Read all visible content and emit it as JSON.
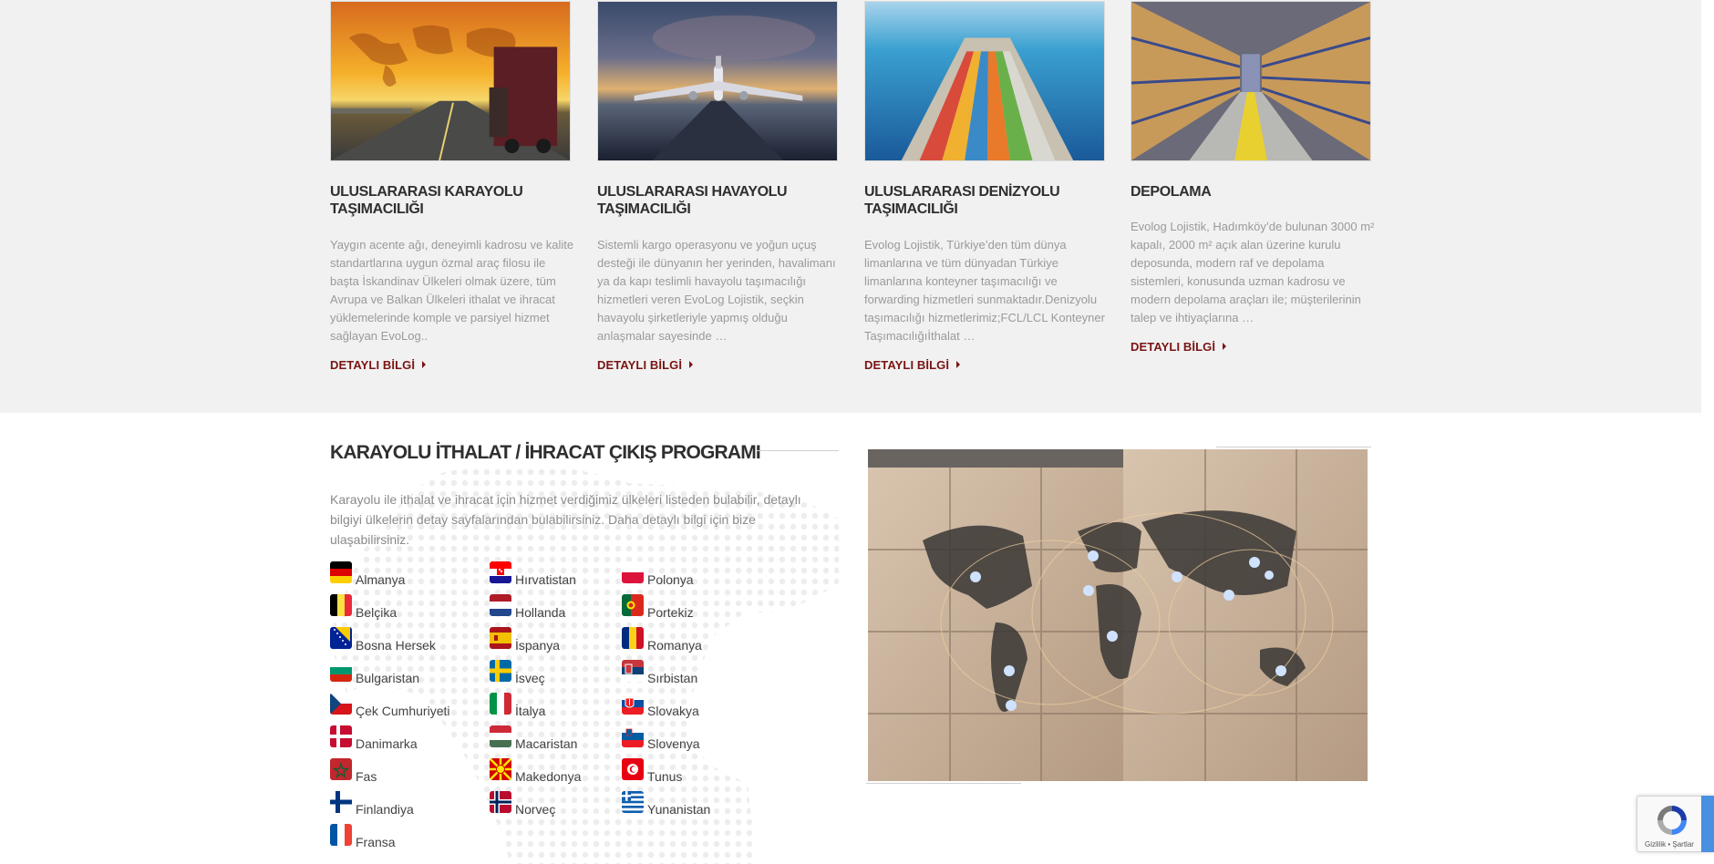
{
  "services": [
    {
      "title": "ULUSLARARASI KARAYOLU TAŞIMACILIĞI",
      "description": "Yaygın acente ağı, deneyimli kadrosu ve kalite standartlarına uygun özmal araç filosu ile başta İskandinav Ülkeleri olmak üzere, tüm Avrupa ve Balkan Ülkeleri ithalat ve ihracat yüklemelerinde komple ve parsiyel hizmet sağlayan EvoLog..",
      "link": "DETAYLI BİLGİ",
      "image": "truck-sunset-photo"
    },
    {
      "title": "ULUSLARARASI HAVAYOLU TAŞIMACILIĞI",
      "description": "Sistemli kargo operasyonu ve yoğun uçuş desteği ile dünyanın her yerinden, havalimanı ya da kapı teslimli havayolu taşımacılığı hizmetleri veren EvoLog Lojistik, seçkin havayolu şirketleriyle yapmış olduğu anlaşmalar sayesinde …",
      "link": "DETAYLI BİLGİ",
      "image": "airplane-runway-photo"
    },
    {
      "title": "ULUSLARARASI DENİZYOLU TAŞIMACILIĞI",
      "description": "Evolog Lojistik, Türkiye’den tüm dünya limanlarına ve tüm dünyadan Türkiye limanlarına konteyner taşımacılığı ve forwarding hizmetleri sunmaktadır.Denizyolu taşımacılığı hizmetlerimiz;FCL/LCL Konteyner Taşımacılığıİthalat …",
      "link": "DETAYLI BİLGİ",
      "image": "container-ship-photo"
    },
    {
      "title": "DEPOLAMA",
      "description": "Evolog Lojistik, Hadımköy’de bulunan 3000 m² kapalı, 2000 m² açık alan üzerine kurulu deposunda, modern raf ve depolama sistemleri, konusunda uzman kadrosu ve modern depolama araçları ile; müşterilerinin talep ve ihtiyaçlarına …",
      "link": "DETAYLI BİLGİ",
      "image": "warehouse-photo"
    }
  ],
  "program": {
    "title": "KARAYOLU İTHALAT / İHRACAT ÇIKIŞ PROGRAMI",
    "description": "Karayolu ile ithalat ve ihracat için hizmet verdiğimiz ülkeleri listeden bulabilir, detaylı bilgiyi ülkelerin detay sayfalarından bulabilirsiniz. Daha detaylı bilgi için bize ulaşabilirsiniz.",
    "columns": [
      [
        {
          "name": "Almanya",
          "flag": "germany"
        },
        {
          "name": "Belçika",
          "flag": "belgium"
        },
        {
          "name": "Bosna Hersek",
          "flag": "bosnia"
        },
        {
          "name": "Bulgaristan",
          "flag": "bulgaria"
        },
        {
          "name": "Çek Cumhuriyeti",
          "flag": "czech"
        },
        {
          "name": "Danimarka",
          "flag": "denmark"
        },
        {
          "name": "Fas",
          "flag": "morocco"
        },
        {
          "name": "Finlandiya",
          "flag": "finland"
        },
        {
          "name": "Fransa",
          "flag": "france"
        }
      ],
      [
        {
          "name": "Hırvatistan",
          "flag": "croatia"
        },
        {
          "name": "Hollanda",
          "flag": "netherlands"
        },
        {
          "name": "İspanya",
          "flag": "spain"
        },
        {
          "name": "İsveç",
          "flag": "sweden"
        },
        {
          "name": "İtalya",
          "flag": "italy"
        },
        {
          "name": "Macaristan",
          "flag": "hungary"
        },
        {
          "name": "Makedonya",
          "flag": "macedonia"
        },
        {
          "name": "Norveç",
          "flag": "norway"
        }
      ],
      [
        {
          "name": "Polonya",
          "flag": "poland"
        },
        {
          "name": "Portekiz",
          "flag": "portugal"
        },
        {
          "name": "Romanya",
          "flag": "romania"
        },
        {
          "name": "Sırbistan",
          "flag": "serbia"
        },
        {
          "name": "Slovakya",
          "flag": "slovakia"
        },
        {
          "name": "Slovenya",
          "flag": "slovenia"
        },
        {
          "name": "Tunus",
          "flag": "tunisia"
        },
        {
          "name": "Yunanistan",
          "flag": "greece"
        }
      ]
    ],
    "image": "world-map-crates-photo"
  },
  "recaptcha": {
    "terms": "Gizlilik • Şartlar",
    "icon": "recaptcha-icon"
  },
  "colors": {
    "accent": "#7a1414",
    "section_bg": "#f1f1f1",
    "title": "#2f2f2f",
    "text_muted": "#9a9a9a"
  }
}
